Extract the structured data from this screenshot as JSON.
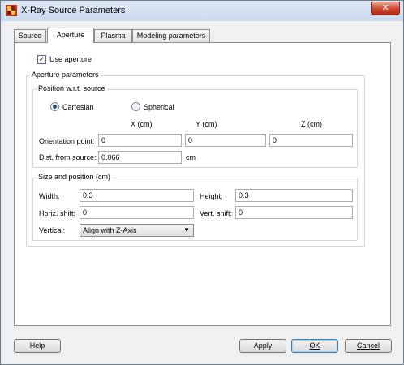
{
  "window": {
    "title": "X-Ray Source Parameters",
    "close_glyph": "✕",
    "icon": "app-icon"
  },
  "tabs": [
    {
      "label": "Source",
      "active": false
    },
    {
      "label": "Aperture",
      "active": true
    },
    {
      "label": "Plasma",
      "active": false
    },
    {
      "label": "Modeling parameters",
      "active": false
    }
  ],
  "use_aperture": {
    "label": "Use aperture",
    "checked": true
  },
  "aperture_params": {
    "title": "Aperture parameters",
    "position": {
      "title": "Position w.r.t. source",
      "cartesian_label": "Cartesian",
      "spherical_label": "Spherical",
      "selected": "Cartesian",
      "col_x": "X (cm)",
      "col_y": "Y (cm)",
      "col_z": "Z (cm)",
      "orientation_label": "Orientation point:",
      "orientation_x": "0",
      "orientation_y": "0",
      "orientation_z": "0",
      "dist_label": "Dist. from source:",
      "dist_value": "0.066",
      "dist_unit": "cm"
    },
    "size": {
      "title": "Size and position (cm)",
      "width_label": "Width:",
      "width_value": "0.3",
      "height_label": "Height:",
      "height_value": "0.3",
      "hshift_label": "Horiz. shift:",
      "hshift_value": "0",
      "vshift_label": "Vert. shift:",
      "vshift_value": "0",
      "vertical_label": "Vertical:",
      "vertical_value": "Align with Z-Axis"
    }
  },
  "buttons": {
    "help": "Help",
    "apply": "Apply",
    "ok": "OK",
    "cancel": "Cancel"
  }
}
